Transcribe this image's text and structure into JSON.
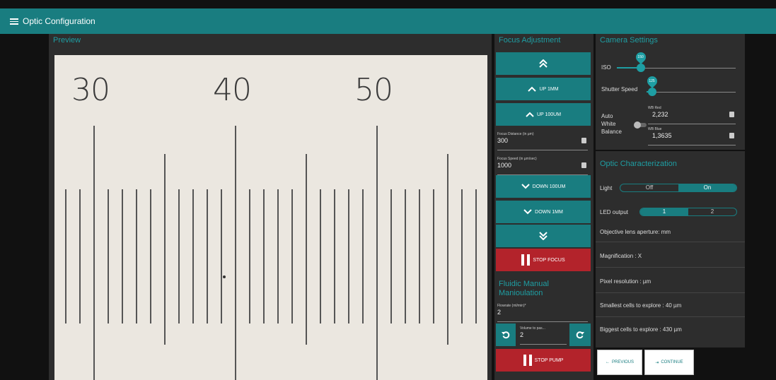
{
  "app": {
    "title": "Optic Configuration"
  },
  "preview": {
    "title": "Preview",
    "scale_numbers": [
      "30",
      "40",
      "50"
    ]
  },
  "focus": {
    "title": "Focus Adjustment",
    "up_1mm": "UP 1MM",
    "up_100um": "UP 100UM",
    "distance_label": "Focus Distance (in µm)",
    "distance_value": "300",
    "speed_label": "Focus Speed (in µm/sec)",
    "speed_value": "1000",
    "down_100um": "DOWN 100UM",
    "down_1mm": "DOWN 1MM",
    "stop_focus": "STOP FOCUS"
  },
  "fluidic": {
    "title": "Fluidic Manual Manioulation",
    "flowrate_label": "Flowrate (ml/min)*",
    "flowrate_value": "2",
    "volume_label": "Volume to pas...",
    "volume_value": "2",
    "stop_pump": "STOP PUMP"
  },
  "camera": {
    "title": "Camera Settings",
    "iso_label": "ISO",
    "iso_value": "150",
    "iso_fraction": 0.2,
    "shutter_label": "Shutter Speed",
    "shutter_value": "125",
    "shutter_fraction": 0.06,
    "awb_label": [
      "Auto",
      "White",
      "Balance"
    ],
    "wb_red_label": "WB Red",
    "wb_red_value": "2,232",
    "wb_blue_label": "WB Blue",
    "wb_blue_value": "1,3635"
  },
  "optic": {
    "title": "Optic Characterization",
    "light_label": "Light",
    "light_off": "Off",
    "light_on": "On",
    "led_label": "LED output",
    "led_1": "1",
    "led_2": "2",
    "aperture": "Objective lens aperture: mm",
    "magnification": "Magnification : X",
    "pixel_res": "Pixel resolution : µm",
    "smallest": "Smallest cells to explore : 40 µm",
    "biggest": "Biggest cells to explore : 430 µm"
  },
  "nav": {
    "previous": "PREVIOUS",
    "continue": "CONTINUE"
  },
  "colors": {
    "accent": "#197d80",
    "danger": "#b3232b",
    "panel": "#2d2d2d"
  }
}
